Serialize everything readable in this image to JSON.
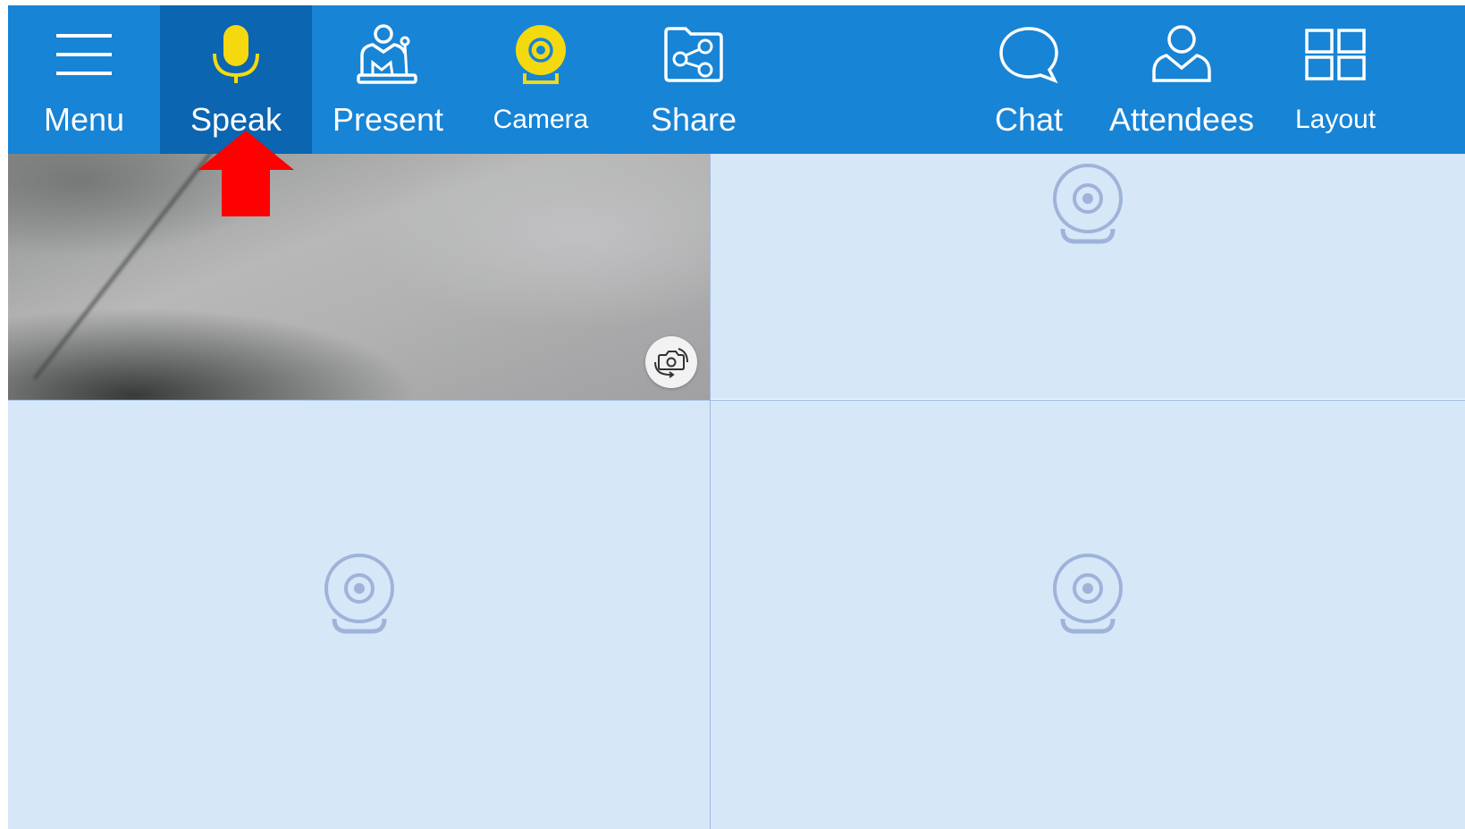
{
  "toolbar": {
    "buttons": [
      {
        "label": "Menu",
        "icon": "hamburger-menu-icon"
      },
      {
        "label": "Speak",
        "icon": "microphone-icon",
        "active": true
      },
      {
        "label": "Present",
        "icon": "presenter-icon"
      },
      {
        "label": "Camera",
        "icon": "webcam-icon"
      },
      {
        "label": "Share",
        "icon": "share-folder-icon"
      },
      {
        "label": "Chat",
        "icon": "chat-bubble-icon"
      },
      {
        "label": "Attendees",
        "icon": "attendee-person-icon"
      },
      {
        "label": "Layout",
        "icon": "grid-layout-icon"
      }
    ]
  },
  "video_grid": {
    "tiles": [
      {
        "state": "local-video",
        "icon": "switch-camera-icon"
      },
      {
        "state": "empty",
        "icon": "webcam-placeholder-icon"
      },
      {
        "state": "empty",
        "icon": "webcam-placeholder-icon"
      },
      {
        "state": "empty",
        "icon": "webcam-placeholder-icon"
      }
    ]
  },
  "annotation": {
    "icon": "red-up-arrow-icon",
    "points_to": "Speak"
  },
  "colors": {
    "toolbar_bg": "#1784d6",
    "toolbar_active_bg": "#0b65b0",
    "accent_yellow": "#f5d90f",
    "tile_bg": "#d6e7f8",
    "placeholder_icon": "#9fb3da",
    "arrow_red": "#ff0000"
  }
}
